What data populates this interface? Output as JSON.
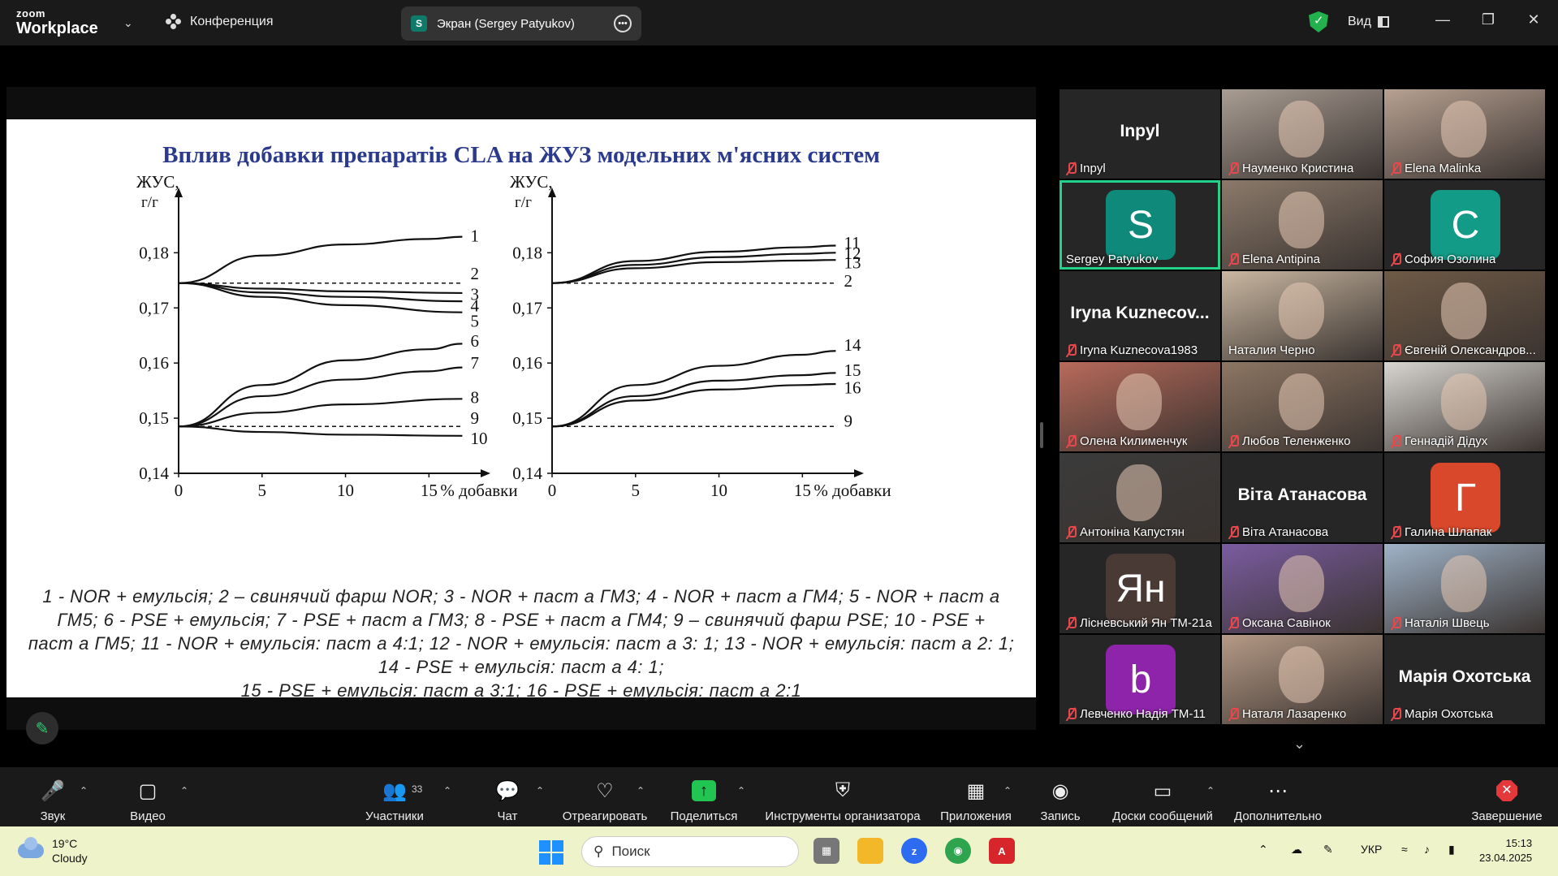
{
  "titlebar": {
    "brand_top": "zoom",
    "brand_bottom": "Workplace",
    "conference_label": "Конференция",
    "screen_pill_badge": "S",
    "screen_pill_label": "Экран (Sergey Patyukov)",
    "view_label": "Вид",
    "icons": [
      "chevron-down-icon",
      "participants-icon",
      "more-icon",
      "shield-check-icon",
      "view-icon",
      "minimize-icon",
      "restore-icon",
      "close-icon"
    ]
  },
  "slide": {
    "title": "Вплив добавки препаратів CLA на ЖУЗ модельних м'ясних систем",
    "legend_lines": [
      "1 - NOR + емульсія; 2 – свинячий фарш NOR; 3 - NOR + паст а ГМ3; 4 - NOR + паст а ГМ4; 5 - NOR + паст а",
      "ГМ5; 6 - PSE + емульсія; 7 - PSE + паст а ГМ3; 8 - PSE + паст а ГМ4; 9 – свинячий фарш PSE; 10 - PSE +",
      "паст а ГМ5; 11 - NOR + емульсія: паст а 4:1; 12 - NOR + емульсія: паст а 3: 1; 13 - NOR + емульсія: паст а 2: 1;",
      "14 - PSE + емульсія: паст а 4: 1;",
      "15 - PSE + емульсія: паст а 3:1; 16 - PSE + емульсія: паст а 2:1"
    ]
  },
  "chart_data": [
    {
      "type": "line",
      "ylabel_line1": "ЖУС,",
      "ylabel_line2": "г/г",
      "xlabel": "% добавки",
      "x_ticks": [
        "0",
        "5",
        "10",
        "15"
      ],
      "y_ticks": [
        "0,14",
        "0,15",
        "0,16",
        "0,17",
        "0,18"
      ],
      "xlim": [
        0,
        18
      ],
      "ylim": [
        0.14,
        0.188
      ],
      "series": [
        {
          "name": "1",
          "x": [
            0,
            5,
            10,
            15,
            17
          ],
          "y": [
            0.1745,
            0.1795,
            0.1815,
            0.1825,
            0.1829
          ],
          "dashed": false
        },
        {
          "name": "2",
          "x": [
            0,
            17
          ],
          "y": [
            0.1745,
            0.1745
          ],
          "dashed": true
        },
        {
          "name": "3",
          "x": [
            0,
            5,
            10,
            17
          ],
          "y": [
            0.1745,
            0.1735,
            0.173,
            0.1727
          ],
          "dashed": false
        },
        {
          "name": "4",
          "x": [
            0,
            5,
            10,
            17
          ],
          "y": [
            0.1745,
            0.1728,
            0.172,
            0.1712
          ],
          "dashed": false
        },
        {
          "name": "5",
          "x": [
            0,
            5,
            10,
            17
          ],
          "y": [
            0.1745,
            0.172,
            0.1705,
            0.1692
          ],
          "dashed": false
        },
        {
          "name": "6",
          "x": [
            0,
            5,
            10,
            15,
            17
          ],
          "y": [
            0.1485,
            0.156,
            0.1605,
            0.1625,
            0.1635
          ],
          "dashed": false
        },
        {
          "name": "7",
          "x": [
            0,
            5,
            10,
            15,
            17
          ],
          "y": [
            0.1485,
            0.154,
            0.157,
            0.1585,
            0.1592
          ],
          "dashed": false
        },
        {
          "name": "8",
          "x": [
            0,
            5,
            10,
            17
          ],
          "y": [
            0.1485,
            0.151,
            0.1525,
            0.1535
          ],
          "dashed": false
        },
        {
          "name": "9",
          "x": [
            0,
            17
          ],
          "y": [
            0.1485,
            0.1485
          ],
          "dashed": true
        },
        {
          "name": "10",
          "x": [
            0,
            5,
            10,
            17
          ],
          "y": [
            0.1485,
            0.1475,
            0.147,
            0.1468
          ],
          "dashed": false
        }
      ],
      "label_y": {
        "1": 0.1831,
        "2": 0.1762,
        "3": 0.1725,
        "4": 0.1704,
        "5": 0.1676,
        "6": 0.164,
        "7": 0.16,
        "8": 0.1538,
        "9": 0.15,
        "10": 0.1463
      }
    },
    {
      "type": "line",
      "ylabel_line1": "ЖУС,",
      "ylabel_line2": "г/г",
      "xlabel": "% добавки",
      "x_ticks": [
        "0",
        "5",
        "10",
        "15"
      ],
      "y_ticks": [
        "0,14",
        "0,15",
        "0,16",
        "0,17",
        "0,18"
      ],
      "xlim": [
        0,
        18
      ],
      "ylim": [
        0.14,
        0.188
      ],
      "series": [
        {
          "name": "11",
          "x": [
            0,
            5,
            10,
            15,
            17
          ],
          "y": [
            0.1745,
            0.1785,
            0.1802,
            0.181,
            0.1813
          ],
          "dashed": false
        },
        {
          "name": "12",
          "x": [
            0,
            5,
            10,
            15,
            17
          ],
          "y": [
            0.1745,
            0.1778,
            0.1792,
            0.1798,
            0.18
          ],
          "dashed": false
        },
        {
          "name": "13",
          "x": [
            0,
            5,
            10,
            15,
            17
          ],
          "y": [
            0.1745,
            0.1772,
            0.1783,
            0.1786,
            0.1787
          ],
          "dashed": false
        },
        {
          "name": "2",
          "x": [
            0,
            17
          ],
          "y": [
            0.1745,
            0.1745
          ],
          "dashed": true
        },
        {
          "name": "14",
          "x": [
            0,
            5,
            10,
            15,
            17
          ],
          "y": [
            0.1485,
            0.156,
            0.1595,
            0.1615,
            0.1622
          ],
          "dashed": false
        },
        {
          "name": "15",
          "x": [
            0,
            5,
            10,
            15,
            17
          ],
          "y": [
            0.1485,
            0.154,
            0.1568,
            0.1578,
            0.1582
          ],
          "dashed": false
        },
        {
          "name": "16",
          "x": [
            0,
            5,
            10,
            15,
            17
          ],
          "y": [
            0.1485,
            0.1532,
            0.1552,
            0.156,
            0.1562
          ],
          "dashed": false
        },
        {
          "name": "9",
          "x": [
            0,
            17
          ],
          "y": [
            0.1485,
            0.1485
          ],
          "dashed": true
        }
      ],
      "label_y": {
        "11": 0.1818,
        "12": 0.1799,
        "13": 0.1782,
        "2": 0.1749,
        "14": 0.1633,
        "15": 0.1587,
        "16": 0.1555,
        "9": 0.1495
      }
    }
  ],
  "annotation_icon": "pencil-icon",
  "gallery": {
    "tiles": [
      {
        "name": "Inpyl",
        "big": "Inpyl",
        "muted": true,
        "kind": "name",
        "color": ""
      },
      {
        "name": "Науменко Кристина",
        "muted": true,
        "kind": "photo",
        "color": "#a99d93"
      },
      {
        "name": "Elena Malinka",
        "muted": true,
        "kind": "photo",
        "color": "#b7a192"
      },
      {
        "name": "Sergey Patyukov",
        "muted": false,
        "kind": "avatar",
        "letter": "S",
        "color": "#0f8a7a",
        "active": true
      },
      {
        "name": "Elena Antipina",
        "muted": true,
        "kind": "photo",
        "color": "#8b7a6b"
      },
      {
        "name": "София Озолина",
        "muted": true,
        "kind": "avatar",
        "letter": "C",
        "color": "#129b86"
      },
      {
        "name": "Iryna Kuznecova1983",
        "big": "Iryna Kuznecov...",
        "muted": true,
        "kind": "name",
        "color": ""
      },
      {
        "name": "Наталия Черно",
        "muted": false,
        "kind": "photo",
        "color": "#c9b7a1"
      },
      {
        "name": "Євгеній Олександров...",
        "muted": true,
        "kind": "photo",
        "color": "#6e5a46"
      },
      {
        "name": "Олена Килименчук",
        "muted": true,
        "kind": "photo",
        "color": "#b86a5a"
      },
      {
        "name": "Любов Теленженко",
        "muted": true,
        "kind": "photo",
        "color": "#8d7663"
      },
      {
        "name": "Геннадій Дідух",
        "muted": true,
        "kind": "photo",
        "color": "#d8d6d0"
      },
      {
        "name": "Антоніна Капустян",
        "muted": true,
        "kind": "photo",
        "color": "#3b3b3b"
      },
      {
        "name": "Віта Атанасова",
        "big": "Віта Атанасова",
        "muted": true,
        "kind": "name",
        "color": ""
      },
      {
        "name": "Галина Шлапак",
        "muted": true,
        "kind": "avatar",
        "letter": "Г",
        "color": "#d9482b"
      },
      {
        "name": "Лісневський Ян ТМ-21а",
        "muted": true,
        "kind": "avatar",
        "letter": "Ян",
        "color": "#4a3a36"
      },
      {
        "name": "Оксана Савінок",
        "muted": true,
        "kind": "photo",
        "color": "#7a5ca0"
      },
      {
        "name": "Наталія Швець",
        "muted": true,
        "kind": "photo",
        "color": "#9fb3c8"
      },
      {
        "name": "Левченко Надія ТМ-11",
        "muted": true,
        "kind": "avatar",
        "letter": "b",
        "color": "#8e24aa"
      },
      {
        "name": "Наталя Лазаренко",
        "muted": true,
        "kind": "photo",
        "color": "#b59a86"
      },
      {
        "name": "Марія Охотська",
        "big": "Марія Охотська",
        "muted": true,
        "kind": "name",
        "color": ""
      }
    ]
  },
  "toolbar": {
    "audio": "Звук",
    "video": "Видео",
    "participants": "Участники",
    "participants_count": "33",
    "chat": "Чат",
    "react": "Отреагировать",
    "share": "Поделиться",
    "host_tools": "Инструменты организатора",
    "apps": "Приложения",
    "record": "Запись",
    "whiteboards": "Доски сообщений",
    "more": "Дополнительно",
    "end": "Завершение"
  },
  "taskbar": {
    "temp": "19°C",
    "condition": "Cloudy",
    "search_placeholder": "Поиск",
    "lang": "УКР",
    "time": "15:13",
    "date": "23.04.2025"
  }
}
